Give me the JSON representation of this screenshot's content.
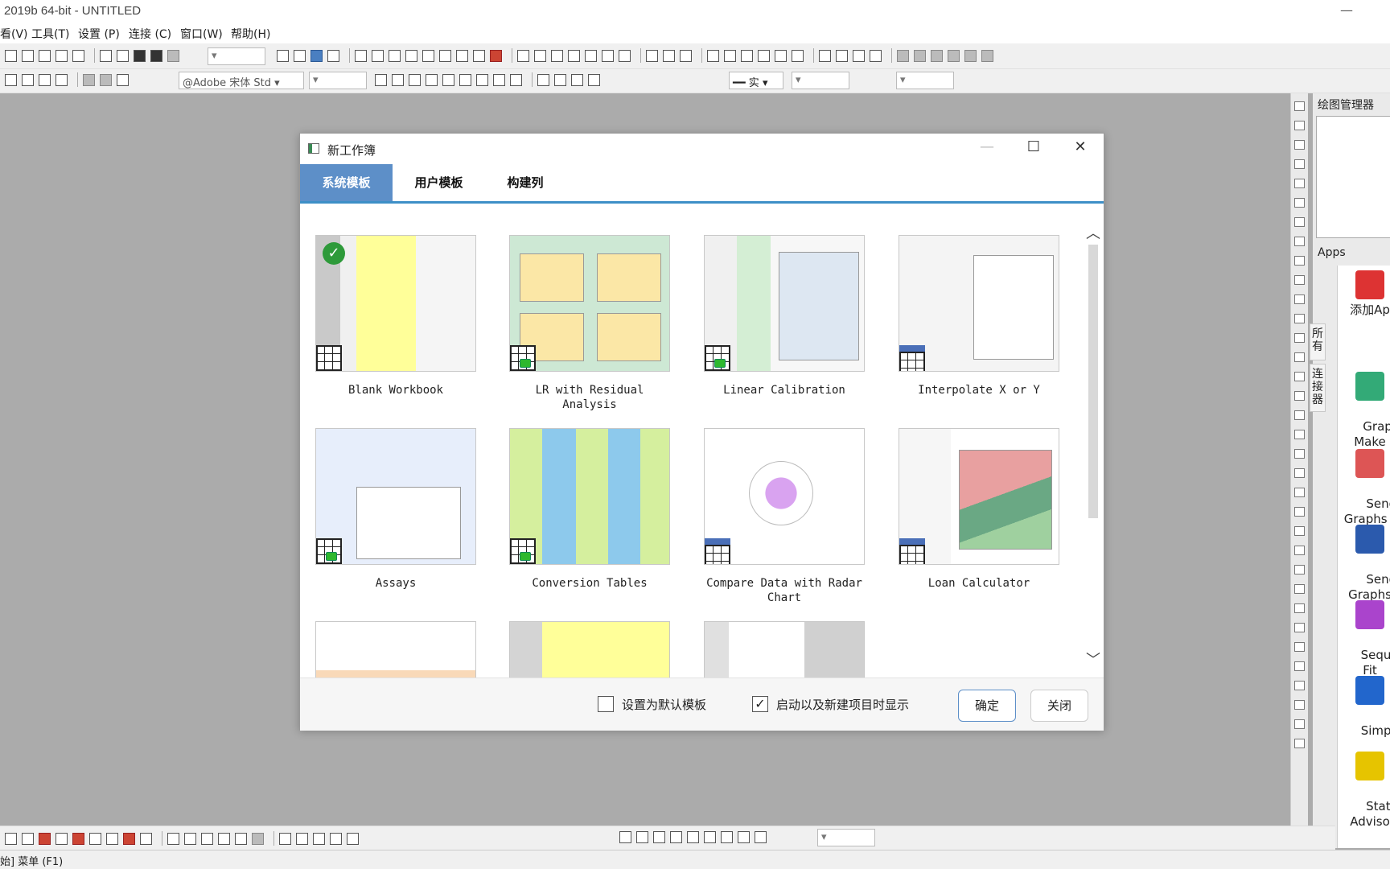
{
  "window": {
    "title": "2019b 64-bit - UNTITLED",
    "minimize_glyph": "—"
  },
  "menu": [
    "看(V)",
    "工具(T)",
    "设置 (P)",
    "连接 (C)",
    "窗口(W)",
    "帮助(H)"
  ],
  "toolbar": {
    "font_name": "@Adobe 宋体 Std",
    "line_style_text": "实"
  },
  "plot_manager": {
    "title": "绘图管理器"
  },
  "side_tabs": [
    "所有",
    "连接器"
  ],
  "apps": {
    "title": "Apps",
    "items": [
      {
        "label": "添加Ap",
        "icon": "add-app-icon",
        "color": "#d33"
      },
      {
        "label": "Graph\nMake",
        "icon": "graph-maker-icon",
        "color": "#3a7"
      },
      {
        "label": "Send\nGraphs t",
        "icon": "send-ppt-icon",
        "color": "#d55"
      },
      {
        "label": "Send\nGraphs",
        "icon": "send-word-icon",
        "color": "#2b5aad"
      },
      {
        "label": "Sequen\nFit",
        "icon": "sequential-fit-icon",
        "color": "#a4c"
      },
      {
        "label": "Simple",
        "icon": "simple-fit-icon",
        "color": "#2266cc"
      },
      {
        "label": "Stats\nAdviso",
        "icon": "stats-advisor-icon",
        "color": "#e6c400"
      }
    ]
  },
  "status": {
    "text": "始] 菜单 (F1)"
  },
  "dialog": {
    "title": "新工作簿",
    "tabs": [
      {
        "label": "系统模板",
        "active": true
      },
      {
        "label": "用户模板",
        "active": false
      },
      {
        "label": "构建列",
        "active": false
      }
    ],
    "templates": [
      {
        "label": "Blank Workbook",
        "selected": true
      },
      {
        "label": "LR with Residual Analysis",
        "selected": false
      },
      {
        "label": "Linear Calibration",
        "selected": false
      },
      {
        "label": "Interpolate X or Y",
        "selected": false
      },
      {
        "label": "Assays",
        "selected": false
      },
      {
        "label": "Conversion Tables",
        "selected": false
      },
      {
        "label": "Compare Data with Radar\nChart",
        "selected": false
      },
      {
        "label": "Loan Calculator",
        "selected": false
      }
    ],
    "checkbox_default": {
      "label": "设置为默认模板",
      "checked": false
    },
    "checkbox_show": {
      "label": "启动以及新建项目时显示",
      "checked": true
    },
    "ok_label": "确定",
    "close_label": "关闭"
  }
}
